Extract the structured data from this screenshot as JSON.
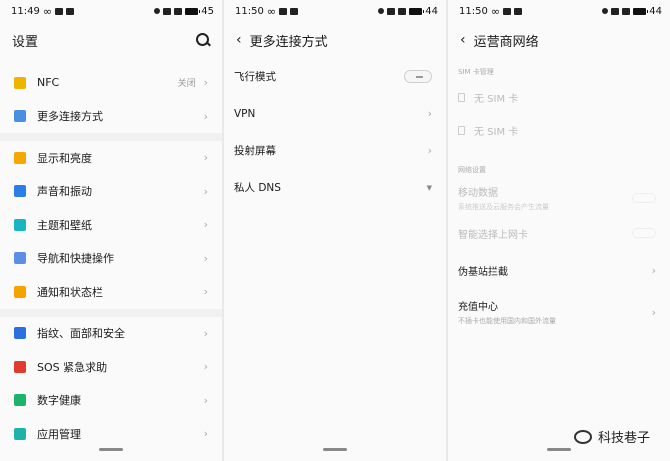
{
  "screens": [
    {
      "status": {
        "time": "11:49",
        "battery": "45"
      },
      "title": "设置",
      "groups": [
        [
          {
            "label": "NFC",
            "value": "关闭",
            "icon": "nfc-icon",
            "color": "#f0b400"
          },
          {
            "label": "更多连接方式",
            "icon": "link-icon",
            "color": "#4a90e2"
          }
        ],
        [
          {
            "label": "显示和亮度",
            "icon": "sun-icon",
            "color": "#f7a800"
          },
          {
            "label": "声音和振动",
            "icon": "speaker-icon",
            "color": "#2b7de9"
          },
          {
            "label": "主题和壁纸",
            "icon": "theme-icon",
            "color": "#19b4c3"
          },
          {
            "label": "导航和快捷操作",
            "icon": "navigation-icon",
            "color": "#5b8ee6"
          },
          {
            "label": "通知和状态栏",
            "icon": "notification-icon",
            "color": "#f5a300"
          }
        ],
        [
          {
            "label": "指纹、面部和安全",
            "icon": "fingerprint-icon",
            "color": "#2b6fe0"
          },
          {
            "label": "SOS 紧急求助",
            "icon": "sos-icon",
            "color": "#e23a2f"
          },
          {
            "label": "数字健康",
            "icon": "health-icon",
            "color": "#1cb46d"
          },
          {
            "label": "应用管理",
            "icon": "apps-icon",
            "color": "#1cb4a8"
          }
        ]
      ]
    },
    {
      "status": {
        "time": "11:50",
        "battery": "44"
      },
      "title": "更多连接方式",
      "rows": [
        {
          "label": "飞行模式",
          "control": "toggle"
        },
        {
          "label": "VPN",
          "control": "chevron"
        },
        {
          "label": "投射屏幕",
          "control": "chevron"
        },
        {
          "label": "私人 DNS",
          "control": "caret"
        }
      ]
    },
    {
      "status": {
        "time": "11:50",
        "battery": "44"
      },
      "title": "运营商网络",
      "sim_header": "SIM 卡管理",
      "sims": [
        "无 SIM 卡",
        "无 SIM 卡"
      ],
      "net_header": "网络设置",
      "mobile_data": {
        "label": "移动数据",
        "desc": "系统推送及云服务会产生流量"
      },
      "smart_select": {
        "label": "智能选择上网卡"
      },
      "fake_station": {
        "label": "伪基站拦截"
      },
      "recharge": {
        "label": "充值中心",
        "desc": "不插卡也能使用国内和国外流量"
      }
    }
  ],
  "watermark": "科技巷子"
}
